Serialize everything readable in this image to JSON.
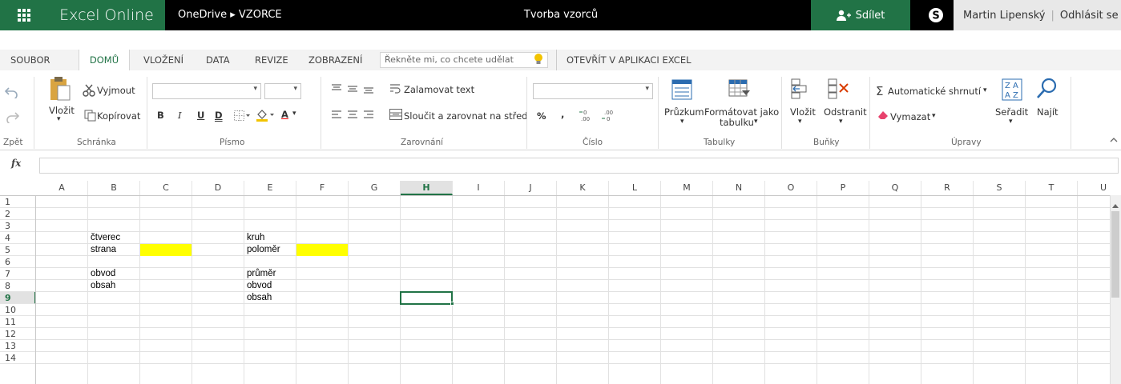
{
  "app": {
    "name": "Excel Online",
    "breadcrumb": "OneDrive ▸ VZORCE",
    "doc_title": "Tvorba vzorců",
    "share_label": "Sdílet",
    "user_name": "Martin Lipenský",
    "sign_out": "Odhlásit se"
  },
  "menu": {
    "tabs": [
      "SOUBOR",
      "DOMŮ",
      "VLOŽENÍ",
      "DATA",
      "REVIZE",
      "ZOBRAZENÍ"
    ],
    "active_tab": "DOMŮ",
    "tell_me_placeholder": "Řekněte mi, co chcete udělat",
    "open_in_excel": "OTEVŘÍT V APLIKACI EXCEL"
  },
  "ribbon": {
    "undo_group": "Zpět",
    "clipboard": {
      "paste": "Vložit",
      "cut": "Vyjmout",
      "copy": "Kopírovat",
      "group": "Schránka"
    },
    "font": {
      "bold": "B",
      "italic": "I",
      "underline": "U",
      "double_underline": "D",
      "font_color_letter": "A",
      "group": "Písmo"
    },
    "alignment": {
      "wrap": "Zalamovat text",
      "merge": "Sloučit a zarovnat na střed",
      "group": "Zarovnání"
    },
    "number": {
      "percent": "%",
      "comma": ",",
      "group": "Číslo"
    },
    "tables": {
      "survey": "Průzkum",
      "format_table_1": "Formátovat jako",
      "format_table_2": "tabulku",
      "group": "Tabulky"
    },
    "cells": {
      "insert": "Vložit",
      "delete": "Odstranit",
      "group": "Buňky"
    },
    "editing": {
      "autosum": "Automatické shrnutí",
      "clear": "Vymazat",
      "sort": "Seřadit",
      "find": "Najít",
      "group": "Úpravy"
    }
  },
  "formula_bar": {
    "label": "fx",
    "value": ""
  },
  "sheet": {
    "columns": [
      "A",
      "B",
      "C",
      "D",
      "E",
      "F",
      "G",
      "H",
      "I",
      "J",
      "K",
      "L",
      "M",
      "N",
      "O",
      "P",
      "Q",
      "R",
      "S",
      "T",
      "U"
    ],
    "rows": [
      "1",
      "2",
      "3",
      "4",
      "5",
      "6",
      "7",
      "8",
      "9",
      "10",
      "11",
      "12",
      "13",
      "14"
    ],
    "selected_column": "H",
    "selected_row": "9",
    "selected_cell": "H9",
    "cells": [
      {
        "ref": "B4",
        "text": "čtverec"
      },
      {
        "ref": "B5",
        "text": "strana"
      },
      {
        "ref": "B7",
        "text": "obvod"
      },
      {
        "ref": "B8",
        "text": "obsah"
      },
      {
        "ref": "E4",
        "text": "kruh"
      },
      {
        "ref": "E5",
        "text": "poloměr"
      },
      {
        "ref": "E7",
        "text": "průměr"
      },
      {
        "ref": "E8",
        "text": "obvod"
      },
      {
        "ref": "E9",
        "text": "obsah"
      }
    ],
    "highlighted_cells": [
      "C5",
      "F5"
    ],
    "highlight_color": "#ffff00"
  },
  "colors": {
    "brand": "#217346",
    "topbar": "#000000"
  }
}
